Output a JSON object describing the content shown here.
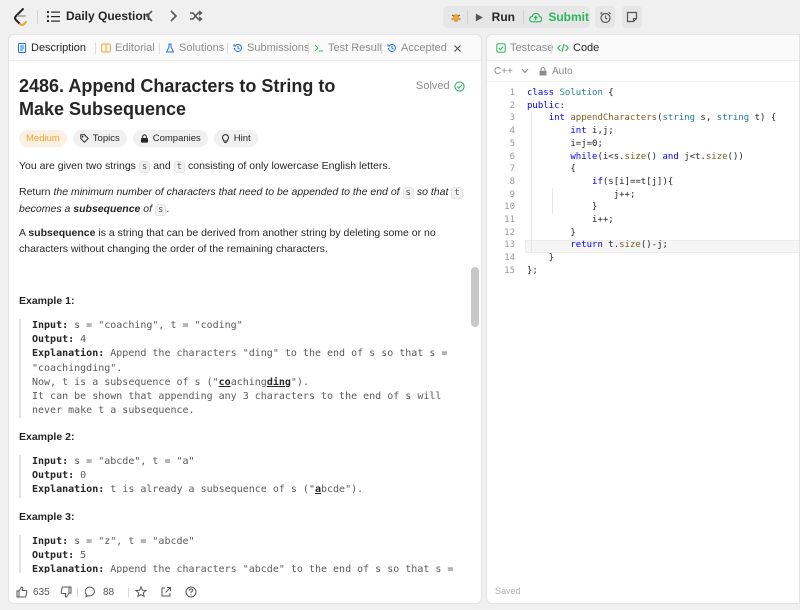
{
  "topbar": {
    "daily_question": "Daily Question",
    "run": "Run",
    "submit": "Submit"
  },
  "left_tabs": [
    {
      "label": "Description"
    },
    {
      "label": "Editorial"
    },
    {
      "label": "Solutions"
    },
    {
      "label": "Submissions"
    },
    {
      "label": "Test Result"
    },
    {
      "label": "Accepted"
    }
  ],
  "problem": {
    "title": "2486. Append Characters to String to Make Subsequence",
    "status": "Solved",
    "difficulty": "Medium",
    "chips": [
      "Topics",
      "Companies",
      "Hint"
    ],
    "p1_a": "You are given two strings ",
    "p1_s": "s",
    "p1_b": " and ",
    "p1_t": "t",
    "p1_c": " consisting of only lowercase English letters.",
    "p2_a": "Return ",
    "p2_b": "the minimum number of characters that need to be appended to the end of ",
    "p2_s": "s",
    "p2_c": " so that ",
    "p2_t": "t",
    "p2_d": "becomes a ",
    "p2_e": "subsequence",
    "p2_f": " of ",
    "p2_s2": "s",
    "p2_g": ".",
    "p3_a": "A ",
    "p3_b": "subsequence",
    "p3_c": " is a string that can be derived from another string by deleting some or no characters without changing the order of the remaining characters."
  },
  "examples": [
    {
      "title": "Example 1:",
      "input_label": "Input:",
      "input": " s = \"coaching\", t = \"coding\"",
      "output_label": "Output:",
      "output": " 4",
      "expl_label": "Explanation:",
      "expl_l1": " Append the characters \"ding\" to the end of s so that s =",
      "expl_l2": "\"coachingding\".",
      "expl_l3a": "Now, t is a subsequence of s (\"",
      "expl_l3b": "co",
      "expl_l3c": "aching",
      "expl_l3d": "ding",
      "expl_l3e": "\").",
      "expl_l4": "It can be shown that appending any 3 characters to the end of s will",
      "expl_l5": "never make t a subsequence."
    },
    {
      "title": "Example 2:",
      "input_label": "Input:",
      "input": " s = \"abcde\", t = \"a\"",
      "output_label": "Output:",
      "output": " 0",
      "expl_label": "Explanation:",
      "expl_l1a": " t is already a subsequence of s (\"",
      "expl_l1b": "a",
      "expl_l1c": "bcde\")."
    },
    {
      "title": "Example 3:",
      "input_label": "Input:",
      "input": " s = \"z\", t = \"abcde\"",
      "output_label": "Output:",
      "output": " 5",
      "expl_label": "Explanation:",
      "expl_l1": " Append the characters \"abcde\" to the end of s so that s ="
    }
  ],
  "bottom": {
    "likes": "635",
    "comments": "88"
  },
  "right_tabs": [
    {
      "label": "Testcase"
    },
    {
      "label": "Code"
    }
  ],
  "editor": {
    "language": "C++",
    "mode": "Auto",
    "saved": "Saved",
    "lines": [
      "class Solution {",
      "public:",
      "    int appendCharacters(string s, string t) {",
      "        int i,j;",
      "        i=j=0;",
      "        while(i<s.size() and j<t.size())",
      "        {",
      "            if(s[i]==t[j]){",
      "                j++;",
      "            }",
      "            i++;",
      "        }",
      "        return t.size()-j;",
      "    }",
      "};"
    ]
  },
  "colors": {
    "accent_green": "#2db55d",
    "accent_blue": "#1a73e8",
    "medium": "#f0a32f"
  }
}
